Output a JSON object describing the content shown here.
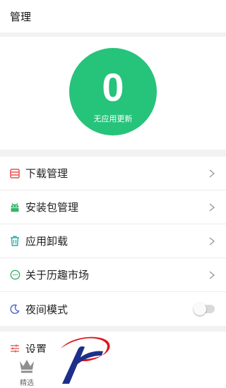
{
  "header": {
    "title": "管理"
  },
  "update": {
    "count": "0",
    "caption": "无应用更新",
    "accent": "#26c37b"
  },
  "menu": {
    "items": [
      {
        "label": "下载管理",
        "icon": "list-icon",
        "color": "#e85050"
      },
      {
        "label": "安装包管理",
        "icon": "android-icon",
        "color": "#35b56a"
      },
      {
        "label": "应用卸载",
        "icon": "trash-icon",
        "color": "#2aa9a0"
      },
      {
        "label": "关于历趣市场",
        "icon": "chat-bubble-icon",
        "color": "#35b56a"
      },
      {
        "label": "夜间模式",
        "icon": "moon-icon",
        "color": "#4f63c9",
        "toggle": "off"
      }
    ]
  },
  "settings": {
    "label": "设置",
    "icon": "sliders-icon",
    "color": "#e85050"
  },
  "tabbar": {
    "label": "精选",
    "icon": "crown-icon"
  }
}
